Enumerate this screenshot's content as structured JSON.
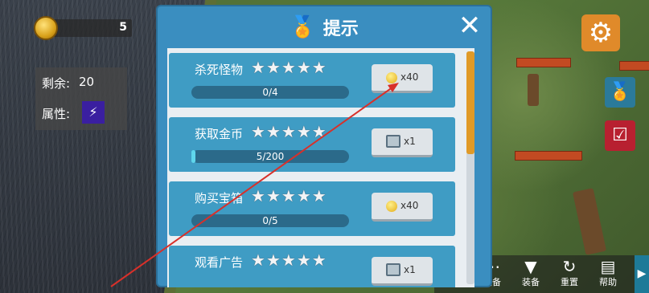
{
  "hud": {
    "coins": "5",
    "remaining_label": "剩余:",
    "remaining_value": "20",
    "attribute_label": "属性:",
    "attribute_icon": "lightning-icon"
  },
  "dialog": {
    "title": "提示",
    "title_icon": "medal-icon",
    "close_icon": "close-icon"
  },
  "tasks": [
    {
      "title": "杀死怪物",
      "stars": 5,
      "progress_text": "0/4",
      "progress_fraction": 0,
      "reward_icon": "coin-icon",
      "reward_qty": "x40"
    },
    {
      "title": "获取金币",
      "stars": 5,
      "progress_text": "5/200",
      "progress_fraction": 0.025,
      "reward_icon": "chest-icon",
      "reward_qty": "x1"
    },
    {
      "title": "购买宝箱",
      "stars": 5,
      "progress_text": "0/5",
      "progress_fraction": 0,
      "reward_icon": "coin-icon",
      "reward_qty": "x40"
    },
    {
      "title": "观看广告",
      "stars": 5,
      "progress_text": "",
      "progress_fraction": 0,
      "reward_icon": "chest-icon",
      "reward_qty": "x1"
    }
  ],
  "right_buttons": {
    "settings_icon": "gear-icon",
    "badge_icon": "medal-icon",
    "tasks_icon": "checklist-icon"
  },
  "bottom_bar": [
    {
      "icon": "dots-icon",
      "label": "装备"
    },
    {
      "icon": "vest-icon",
      "label": "装备"
    },
    {
      "icon": "reset-icon",
      "label": "重置"
    },
    {
      "icon": "help-icon",
      "label": "帮助"
    }
  ],
  "colors": {
    "dialog_bg": "#3a8ec0",
    "card_bg": "#3f9cc4",
    "progress_fill": "#5fd6ec",
    "annotation_arrow": "#d8302a",
    "settings_button": "#e08a2a"
  }
}
